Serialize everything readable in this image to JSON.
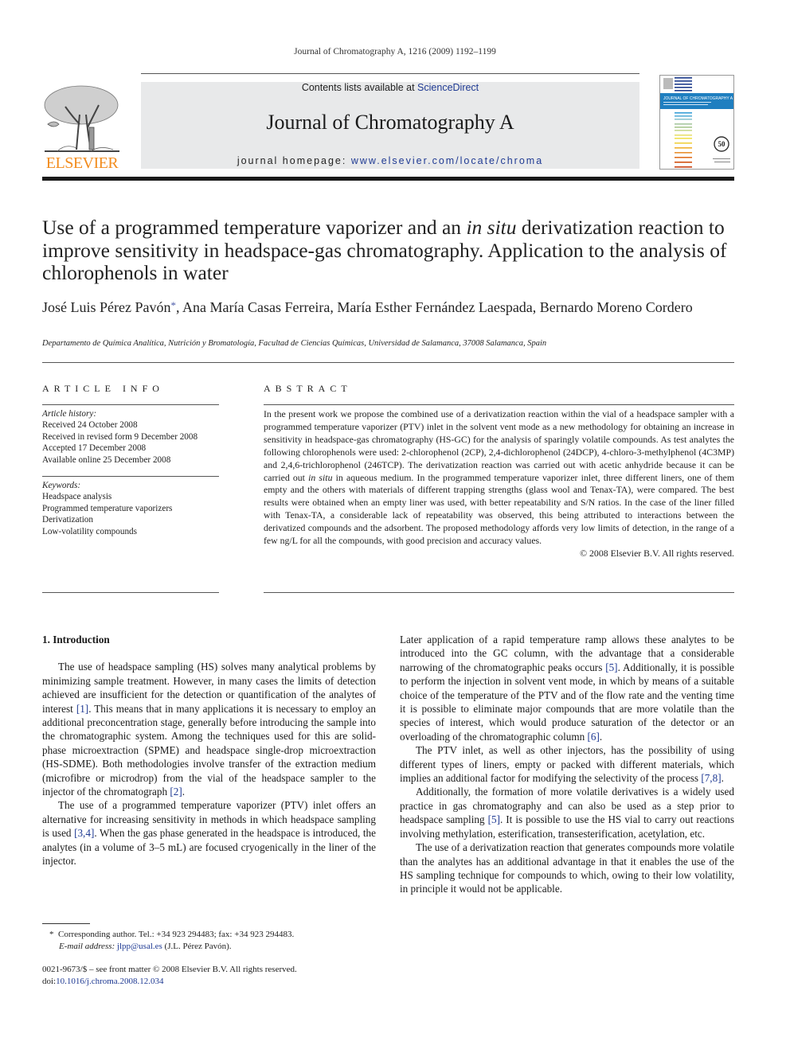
{
  "header": {
    "citation": "Journal of Chromatography A, 1216 (2009) 1192–1199",
    "publisher_logo_text": "ELSEVIER",
    "contents_prefix": "Contents lists available at ",
    "contents_link": "ScienceDirect",
    "journal_title": "Journal of Chromatography A",
    "homepage_prefix": "journal homepage: ",
    "homepage_link": "www.elsevier.com/locate/chroma",
    "cover_label": "JOURNAL OF CHROMATOGRAPHY A",
    "cover_badge": "50"
  },
  "article": {
    "title_part1": "Use of a programmed temperature vaporizer and an ",
    "title_italic": "in situ",
    "title_part2": " derivatization reaction to improve sensitivity in headspace-gas chromatography. Application to the analysis of chlorophenols in water",
    "author1": "José Luis Pérez Pavón",
    "author1_mark": "*",
    "authors_rest": ", Ana María Casas Ferreira, María Esther Fernández Laespada, Bernardo Moreno Cordero",
    "affiliation": "Departamento de Química Analítica, Nutrición y Bromatología, Facultad de Ciencias Químicas, Universidad de Salamanca, 37008 Salamanca, Spain"
  },
  "article_info": {
    "heading": "ARTICLE INFO",
    "history_label": "Article history:",
    "history": [
      "Received 24 October 2008",
      "Received in revised form 9 December 2008",
      "Accepted 17 December 2008",
      "Available online 25 December 2008"
    ],
    "keywords_label": "Keywords:",
    "keywords": [
      "Headspace analysis",
      "Programmed temperature vaporizers",
      "Derivatization",
      "Low-volatility compounds"
    ]
  },
  "abstract": {
    "heading": "ABSTRACT",
    "text_part1": "In the present work we propose the combined use of a derivatization reaction within the vial of a headspace sampler with a programmed temperature vaporizer (PTV) inlet in the solvent vent mode as a new methodology for obtaining an increase in sensitivity in headspace-gas chromatography (HS-GC) for the analysis of sparingly volatile compounds. As test analytes the following chlorophenols were used: 2-chlorophenol (2CP), 2,4-dichlorophenol (24DCP), 4-chloro-3-methylphenol (4C3MP) and 2,4,6-trichlorophenol (246TCP). The derivatization reaction was carried out with acetic anhydride because it can be carried out ",
    "text_italic": "in situ",
    "text_part2": " in aqueous medium. In the programmed temperature vaporizer inlet, three different liners, one of them empty and the others with materials of different trapping strengths (glass wool and Tenax-TA), were compared. The best results were obtained when an empty liner was used, with better repeatability and S/N ratios. In the case of the liner filled with Tenax-TA, a considerable lack of repeatability was observed, this being attributed to interactions between the derivatized compounds and the adsorbent. The proposed methodology affords very low limits of detection, in the range of a few ng/L for all the compounds, with good precision and accuracy values.",
    "rights": "© 2008 Elsevier B.V. All rights reserved."
  },
  "body": {
    "section_heading": "1.  Introduction",
    "p1_a": "The use of headspace sampling (HS) solves many analytical problems by minimizing sample treatment. However, in many cases the limits of detection achieved are insufficient for the detection or quantification of the analytes of interest ",
    "p1_ref1": "[1]",
    "p1_b": ". This means that in many applications it is necessary to employ an additional preconcentration stage, generally before introducing the sample into the chromatographic system. Among the techniques used for this are solid-phase microextraction (SPME) and headspace single-drop microextraction (HS-SDME). Both methodologies involve transfer of the extraction medium (microfibre or microdrop) from the vial of the headspace sampler to the injector of the chromatograph ",
    "p1_ref2": "[2]",
    "p1_c": ".",
    "p2_a": "The use of a programmed temperature vaporizer (PTV) inlet offers an alternative for increasing sensitivity in methods in which headspace sampling is used ",
    "p2_ref": "[3,4]",
    "p2_b": ". When the gas phase generated in the headspace is introduced, the analytes (in a volume of 3–5 mL) are focused cryogenically in the liner of the injector.",
    "p3_a": "Later application of a rapid temperature ramp allows these analytes to be introduced into the GC column, with the advantage that a considerable narrowing of the chromatographic peaks occurs ",
    "p3_ref1": "[5]",
    "p3_b": ". Additionally, it is possible to perform the injection in solvent vent mode, in which by means of a suitable choice of the temperature of the PTV and of the flow rate and the venting time it is possible to eliminate major compounds that are more volatile than the species of interest, which would produce saturation of the detector or an overloading of the chromatographic column ",
    "p3_ref2": "[6]",
    "p3_c": ".",
    "p4_a": "The PTV inlet, as well as other injectors, has the possibility of using different types of liners, empty or packed with different materials, which implies an additional factor for modifying the selectivity of the process ",
    "p4_ref": "[7,8]",
    "p4_b": ".",
    "p5_a": "Additionally, the formation of more volatile derivatives is a widely used practice in gas chromatography and can also be used as a step prior to headspace sampling ",
    "p5_ref": "[5]",
    "p5_b": ". It is possible to use the HS vial to carry out reactions involving methylation, esterification, transesterification, acetylation, etc.",
    "p6": "The use of a derivatization reaction that generates compounds more volatile than the analytes has an additional advantage in that it enables the use of the HS sampling technique for compounds to which, owing to their low volatility, in principle it would not be applicable."
  },
  "footnotes": {
    "mark": "*",
    "corresponding": "Corresponding author. Tel.: +34 923 294483; fax: +34 923 294483.",
    "email_label": "E-mail address: ",
    "email": "jlpp@usal.es",
    "email_suffix": " (J.L. Pérez Pavón).",
    "front_matter": "0021-9673/$ – see front matter © 2008 Elsevier B.V. All rights reserved.",
    "doi_prefix": "doi:",
    "doi": "10.1016/j.chroma.2008.12.034"
  }
}
